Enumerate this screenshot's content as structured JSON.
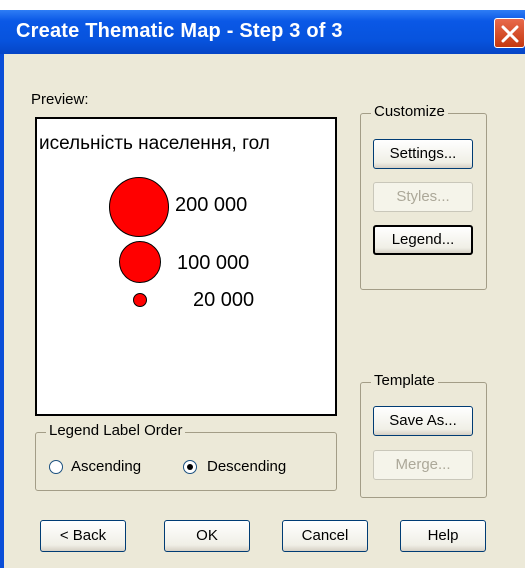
{
  "window": {
    "title": "Create Thematic Map - Step 3 of 3"
  },
  "preview": {
    "label": "Preview:",
    "legend_title": "исельність населення, гол",
    "items": [
      {
        "label": "200 000",
        "color": "#ff0000"
      },
      {
        "label": "100 000",
        "color": "#ff0000"
      },
      {
        "label": "20 000",
        "color": "#ff0000"
      }
    ]
  },
  "customize": {
    "title": "Customize",
    "settings": "Settings...",
    "styles": "Styles...",
    "legend": "Legend..."
  },
  "template": {
    "title": "Template",
    "save_as": "Save As...",
    "merge": "Merge..."
  },
  "legend_order": {
    "title": "Legend Label Order",
    "ascending": "Ascending",
    "descending": "Descending",
    "selected": "Descending"
  },
  "footer": {
    "back": "< Back",
    "ok": "OK",
    "cancel": "Cancel",
    "help": "Help"
  }
}
